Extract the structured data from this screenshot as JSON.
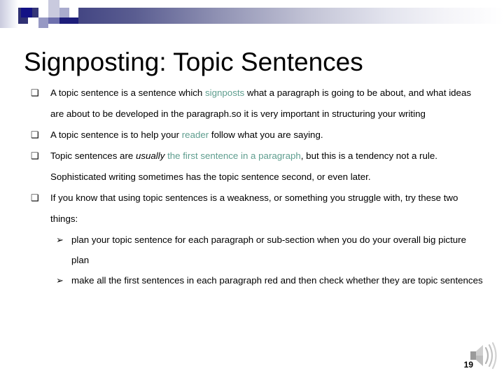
{
  "slide": {
    "title": "Signposting: Topic Sentences",
    "page_number": "19",
    "accent_color": "#5f9e8f",
    "header_gradient_from": "#2e2f72",
    "header_gradient_to": "#ffffff",
    "bullet_marker": "❑",
    "sub_bullet_marker": "➢",
    "sound_icon_name": "speaker-icon"
  },
  "bullets": [
    {
      "marker": "❑",
      "segments": [
        {
          "text": "A topic sentence is a sentence which ",
          "style": "normal"
        },
        {
          "text": "signposts",
          "style": "accent"
        },
        {
          "text": " what a paragraph is going to be about, and what ideas are about to be developed in the paragraph.so it is very important in structuring your writing",
          "style": "normal"
        }
      ]
    },
    {
      "marker": "❑",
      "segments": [
        {
          "text": "A topic sentence is to help your ",
          "style": "normal"
        },
        {
          "text": "reader",
          "style": "accent"
        },
        {
          "text": " follow what you are saying.",
          "style": "normal"
        }
      ]
    },
    {
      "marker": "❑",
      "segments": [
        {
          "text": "Topic sentences are ",
          "style": "normal"
        },
        {
          "text": "usually",
          "style": "italic"
        },
        {
          "text": " ",
          "style": "normal"
        },
        {
          "text": "the first sentence in a paragraph",
          "style": "accent"
        },
        {
          "text": ", but this is a tendency not a rule.  Sophisticated writing sometimes has the topic sentence second, or even later.",
          "style": "normal"
        }
      ]
    },
    {
      "marker": "❑",
      "segments": [
        {
          "text": "If you know that using topic sentences is a weakness, or something you struggle with, try these two things:",
          "style": "normal"
        }
      ]
    }
  ],
  "sub_bullets": [
    {
      "marker": "➢",
      "text": "plan your topic sentence for each paragraph or sub-section when you do your overall big picture plan"
    },
    {
      "marker": "➢",
      "text": "make all the first sentences in each paragraph red and then check whether they are topic sentences"
    }
  ]
}
